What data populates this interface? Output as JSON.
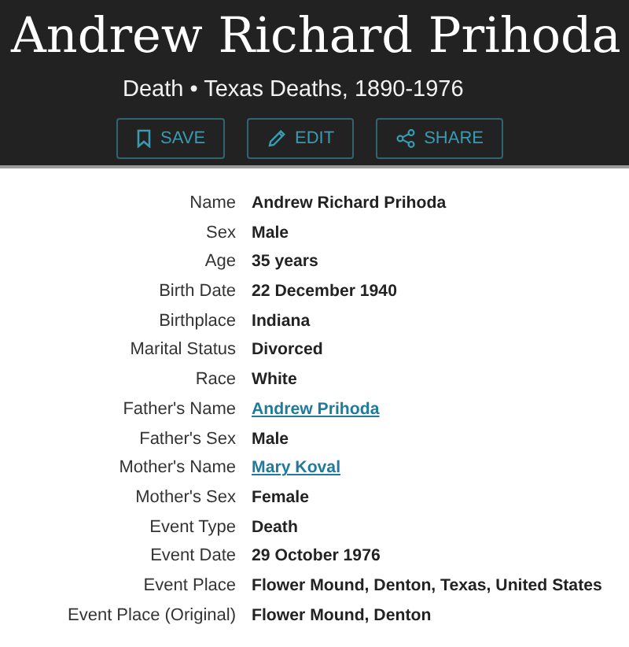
{
  "header": {
    "title": "Andrew Richard Prihoda",
    "subtitle": "Death • Texas Deaths, 1890-1976",
    "buttons": [
      {
        "kind": "save",
        "label": "SAVE"
      },
      {
        "kind": "edit",
        "label": "EDIT"
      },
      {
        "kind": "share",
        "label": "SHARE"
      }
    ]
  },
  "facts": [
    {
      "label": "Name",
      "value": "Andrew Richard Prihoda",
      "kind": "text"
    },
    {
      "label": "Sex",
      "value": "Male",
      "kind": "text"
    },
    {
      "label": "Age",
      "value": "35 years",
      "kind": "text"
    },
    {
      "label": "Birth Date",
      "value": "22 December 1940",
      "kind": "text"
    },
    {
      "label": "Birthplace",
      "value": "Indiana",
      "kind": "text"
    },
    {
      "label": "Marital Status",
      "value": "Divorced",
      "kind": "text"
    },
    {
      "label": "Race",
      "value": "White",
      "kind": "text"
    },
    {
      "label": "Father's Name",
      "value": "Andrew Prihoda",
      "kind": "link"
    },
    {
      "label": "Father's Sex",
      "value": "Male",
      "kind": "text"
    },
    {
      "label": "Mother's Name",
      "value": "Mary Koval",
      "kind": "link"
    },
    {
      "label": "Mother's Sex",
      "value": "Female",
      "kind": "text"
    },
    {
      "label": "Event Type",
      "value": "Death",
      "kind": "text"
    },
    {
      "label": "Event Date",
      "value": "29 October 1976",
      "kind": "text"
    },
    {
      "label": "Event Place",
      "value": "Flower Mound, Denton, Texas, United States",
      "kind": "text"
    },
    {
      "label": "Event Place (Original)",
      "value": "Flower Mound, Denton",
      "kind": "text"
    }
  ]
}
